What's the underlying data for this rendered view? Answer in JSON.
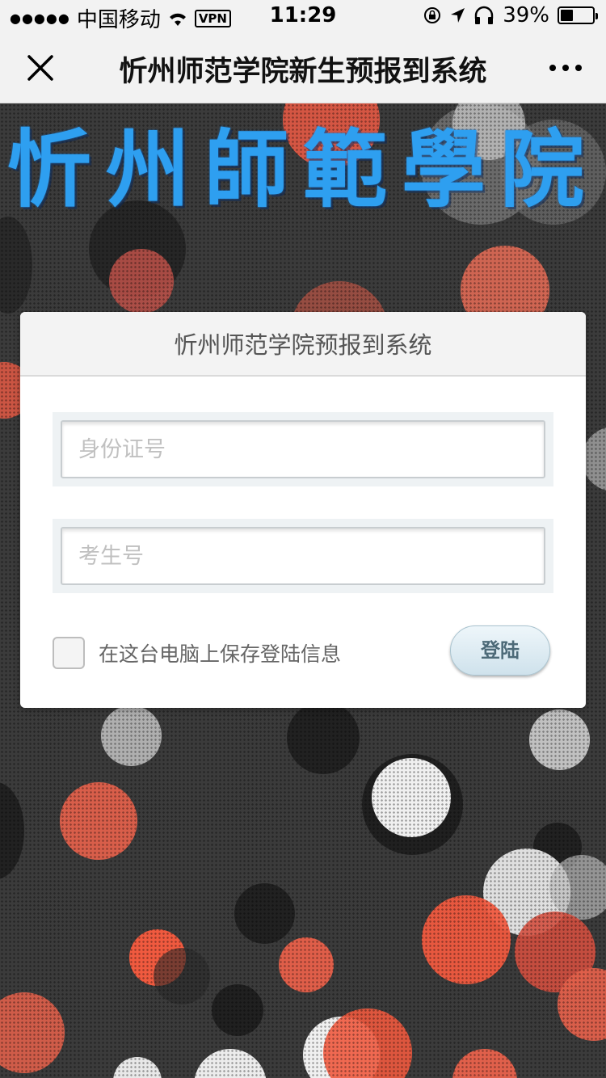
{
  "status_bar": {
    "carrier": "中国移动",
    "vpn": "VPN",
    "time": "11:29",
    "battery": "39%",
    "battery_level": 0.39
  },
  "nav": {
    "title": "忻州师范学院新生预报到系统",
    "close_icon": "close-icon",
    "more_icon": "more-icon"
  },
  "brand": {
    "text": "忻州師範學院",
    "color": "#2e9ff0"
  },
  "login_card": {
    "title": "忻州师范学院预报到系统",
    "id_placeholder": "身份证号",
    "exam_placeholder": "考生号",
    "remember_label": "在这台电脑上保存登陆信息",
    "login_label": "登陆"
  }
}
